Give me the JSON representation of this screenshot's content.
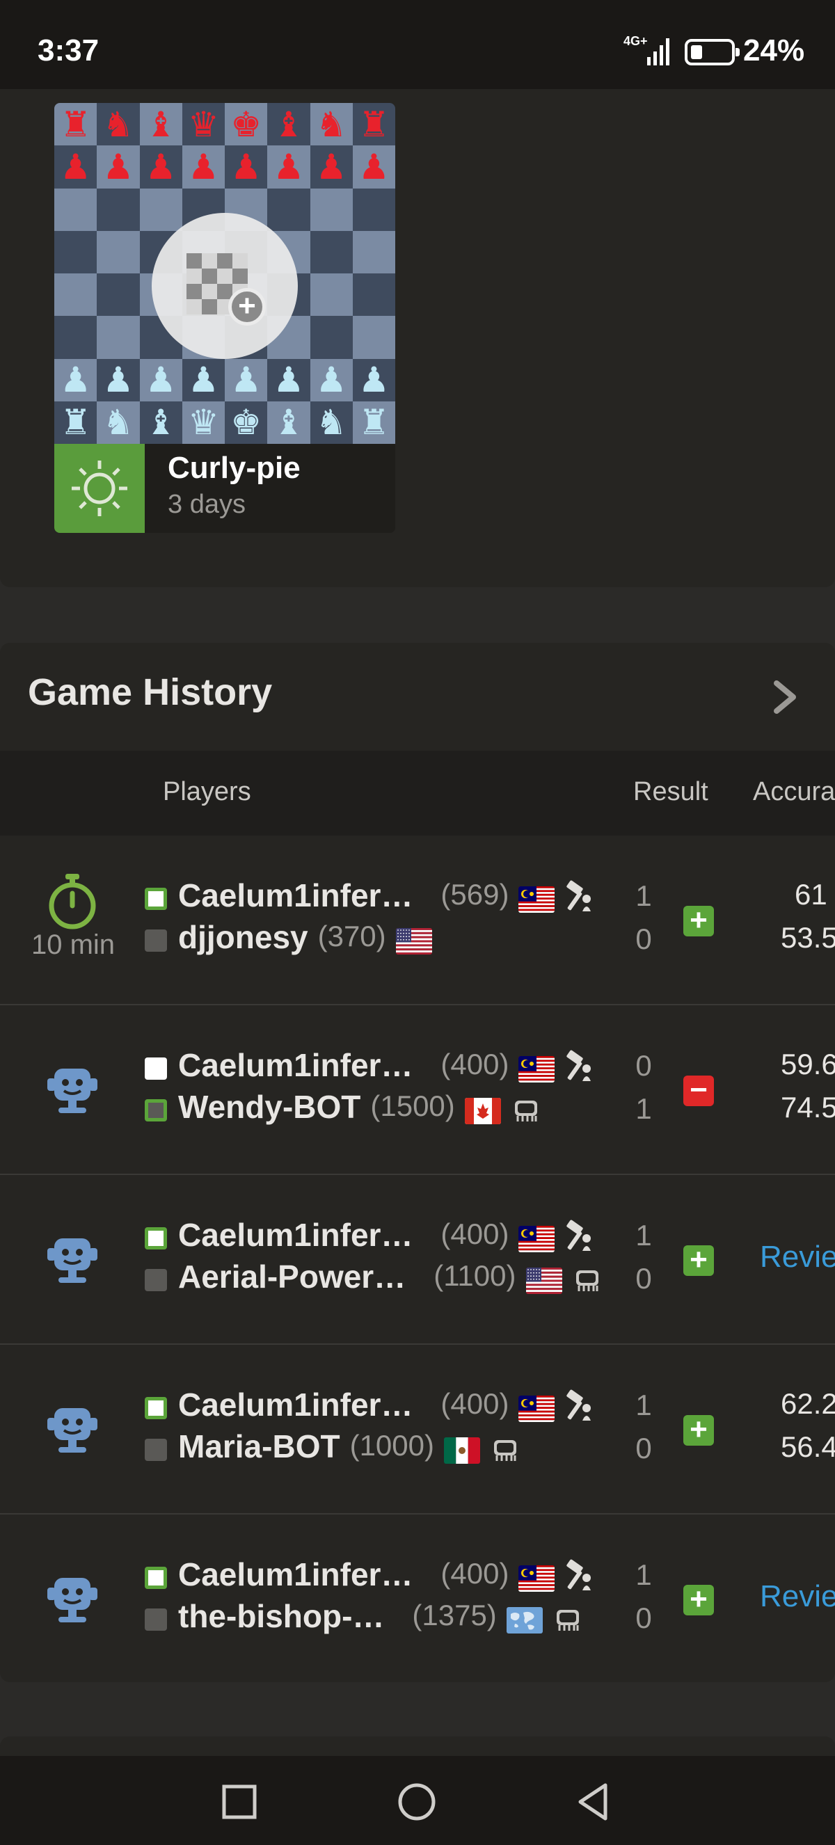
{
  "status_bar": {
    "time": "3:37",
    "network": "4G+",
    "battery": "24%",
    "battery_level": 0.24
  },
  "daily_game": {
    "opponent": "Curly-pie",
    "time_left": "3 days",
    "add_icon": "new-game-board-plus-icon",
    "sun_icon": "sun-icon"
  },
  "history": {
    "title": "Game History",
    "columns": {
      "players": "Players",
      "result": "Result",
      "accuracy": "Accura"
    },
    "review_label": "Revie",
    "games": [
      {
        "type_icon": "stopwatch-icon",
        "type_label": "10 min",
        "white": {
          "name": "Caelum1infer…",
          "rating": "(569)",
          "flag": "MY",
          "badge": "pawn-hammer-icon",
          "won": true
        },
        "black": {
          "name": "djjonesy",
          "rating": "(370)",
          "flag": "US",
          "badge": "",
          "won": false
        },
        "score_white": "1",
        "score_black": "0",
        "result": "win",
        "acc_white": "61",
        "acc_black": "53.5",
        "review": false
      },
      {
        "type_icon": "robot-icon",
        "type_label": "",
        "white": {
          "name": "Caelum1infer…",
          "rating": "(400)",
          "flag": "MY",
          "badge": "pawn-hammer-icon",
          "won": false
        },
        "black": {
          "name": "Wendy-BOT",
          "rating": "(1500)",
          "flag": "CA",
          "badge": "chip-icon",
          "won": true
        },
        "score_white": "0",
        "score_black": "1",
        "result": "loss",
        "acc_white": "59.6",
        "acc_black": "74.5",
        "review": false
      },
      {
        "type_icon": "robot-icon",
        "type_label": "",
        "white": {
          "name": "Caelum1infer…",
          "rating": "(400)",
          "flag": "MY",
          "badge": "pawn-hammer-icon",
          "won": true
        },
        "black": {
          "name": "Aerial-Power…",
          "rating": "(1100)",
          "flag": "US",
          "badge": "chip-icon",
          "won": false
        },
        "score_white": "1",
        "score_black": "0",
        "result": "win",
        "acc_white": "",
        "acc_black": "",
        "review": true
      },
      {
        "type_icon": "robot-icon",
        "type_label": "",
        "white": {
          "name": "Caelum1infer…",
          "rating": "(400)",
          "flag": "MY",
          "badge": "pawn-hammer-icon",
          "won": true
        },
        "black": {
          "name": "Maria-BOT",
          "rating": "(1000)",
          "flag": "MX",
          "badge": "chip-icon",
          "won": false
        },
        "score_white": "1",
        "score_black": "0",
        "result": "win",
        "acc_white": "62.2",
        "acc_black": "56.4",
        "review": false
      },
      {
        "type_icon": "robot-icon",
        "type_label": "",
        "white": {
          "name": "Caelum1infer…",
          "rating": "(400)",
          "flag": "MY",
          "badge": "pawn-hammer-icon",
          "won": true
        },
        "black": {
          "name": "the-bishop-…",
          "rating": "(1375)",
          "flag": "WORLD",
          "badge": "chip-icon",
          "won": false
        },
        "score_white": "1",
        "score_black": "0",
        "result": "win",
        "acc_white": "",
        "acc_black": "",
        "review": true
      }
    ]
  },
  "nav": {
    "recent_icon": "square-icon",
    "home_icon": "circle-icon",
    "back_icon": "triangle-back-icon"
  },
  "colors": {
    "win_green": "#5ba53a",
    "loss_red": "#e02828",
    "link_blue": "#3a9bd9"
  }
}
